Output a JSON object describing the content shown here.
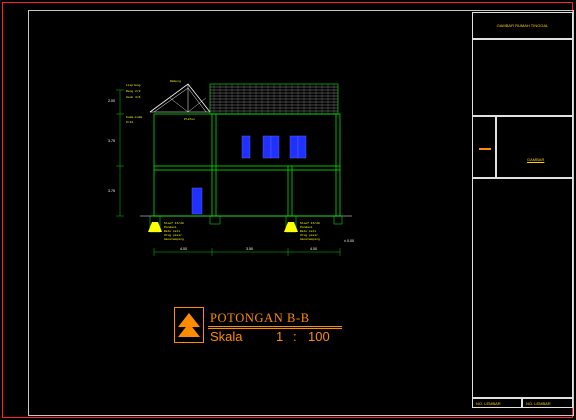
{
  "sheet": {
    "title_block": {
      "project_title": "GAMBAR RUMAH TINGGAL",
      "logo_label": "GAMBAR",
      "footer_left": "NO. LEMBAR",
      "footer_right": "NO. LEMBAR"
    },
    "drawing": {
      "title": "POTONGAN B-B",
      "scale_word": "Skala",
      "scale_left": "1",
      "scale_sep": ":",
      "scale_right": "100"
    },
    "dimensions": {
      "bottom": [
        "4.00",
        "3.50",
        "4.00"
      ],
      "left": [
        "2.00",
        "3.75",
        "3.75"
      ],
      "level": "± 0.00"
    },
    "notes": {
      "roof_top": "Rabung",
      "roof_left_1": "Lisplang",
      "roof_left_2": "Reng 2/3",
      "roof_left_3": "Usuk 4/6",
      "roof_left_4": "Kuda-kuda",
      "roof_left_5": "6/12",
      "ceiling": "Plafon",
      "foundation_left": [
        "Sloof 15/20",
        "Pondasi",
        "Batu kali",
        "Urug pasir",
        "Aanstamping"
      ],
      "foundation_right": [
        "Sloof 15/20",
        "Pondasi",
        "Batu kali",
        "Urug pasir",
        "Aanstamping"
      ]
    },
    "colors": {
      "background": "#000000",
      "lines": "#ffffff",
      "green_struct": "#00ff00",
      "yellow_text": "#ffff00",
      "orange_label": "#ff8c00",
      "window_blue": "#2030ff",
      "border_red": "#ff2020"
    }
  }
}
